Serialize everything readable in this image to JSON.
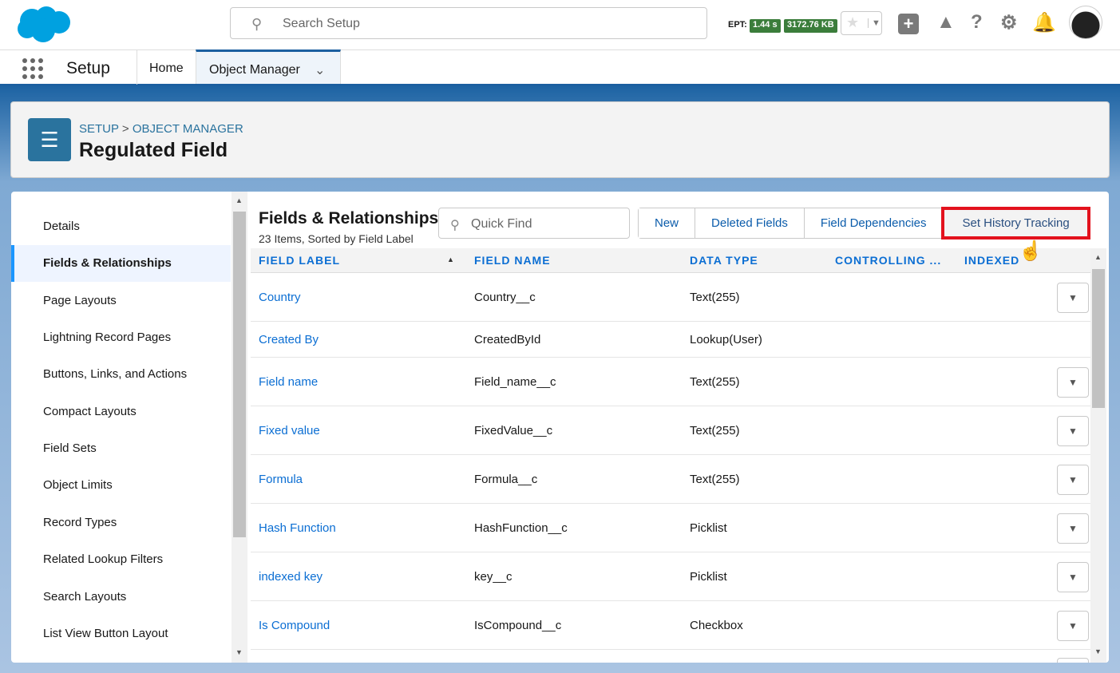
{
  "header": {
    "search_placeholder": "Search Setup",
    "ept_label": "EPT:",
    "ept_time": "1.44 s",
    "ept_size": "3172.76 KB"
  },
  "nav": {
    "app_name": "Setup",
    "tabs": [
      {
        "label": "Home"
      },
      {
        "label": "Object Manager"
      }
    ]
  },
  "page": {
    "breadcrumb_setup": "SETUP",
    "breadcrumb_sep": ">",
    "breadcrumb_om": "OBJECT MANAGER",
    "title": "Regulated Field"
  },
  "sidebar": {
    "items": [
      {
        "label": "Details"
      },
      {
        "label": "Fields & Relationships"
      },
      {
        "label": "Page Layouts"
      },
      {
        "label": "Lightning Record Pages"
      },
      {
        "label": "Buttons, Links, and Actions"
      },
      {
        "label": "Compact Layouts"
      },
      {
        "label": "Field Sets"
      },
      {
        "label": "Object Limits"
      },
      {
        "label": "Record Types"
      },
      {
        "label": "Related Lookup Filters"
      },
      {
        "label": "Search Layouts"
      },
      {
        "label": "List View Button Layout"
      }
    ]
  },
  "section": {
    "title": "Fields & Relationships",
    "subtitle": "23 Items, Sorted by Field Label",
    "quick_find_placeholder": "Quick Find",
    "buttons": {
      "new": "New",
      "deleted": "Deleted Fields",
      "dependencies": "Field Dependencies",
      "history": "Set History Tracking"
    }
  },
  "table": {
    "columns": [
      "FIELD LABEL",
      "FIELD NAME",
      "DATA TYPE",
      "CONTROLLING ...",
      "INDEXED"
    ],
    "rows": [
      {
        "label": "Country",
        "name": "Country__c",
        "type": "Text(255)"
      },
      {
        "label": "Created By",
        "name": "CreatedById",
        "type": "Lookup(User)"
      },
      {
        "label": "Field name",
        "name": "Field_name__c",
        "type": "Text(255)"
      },
      {
        "label": "Fixed value",
        "name": "FixedValue__c",
        "type": "Text(255)"
      },
      {
        "label": "Formula",
        "name": "Formula__c",
        "type": "Text(255)"
      },
      {
        "label": "Hash Function",
        "name": "HashFunction__c",
        "type": "Picklist"
      },
      {
        "label": "indexed key",
        "name": "key__c",
        "type": "Picklist"
      },
      {
        "label": "Is Compound",
        "name": "IsCompound__c",
        "type": "Checkbox"
      }
    ]
  }
}
